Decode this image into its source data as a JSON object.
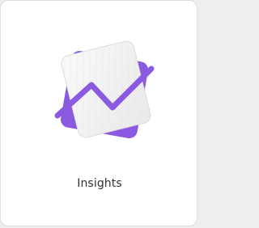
{
  "app": {
    "name": "Insights",
    "icon": "insights-chart-icon"
  },
  "colors": {
    "accent": "#8a5ae0",
    "tile_background": "#ffffff",
    "page_background": "#eeeeee",
    "card_face": "#f4f4f4",
    "label_text": "#333333"
  }
}
